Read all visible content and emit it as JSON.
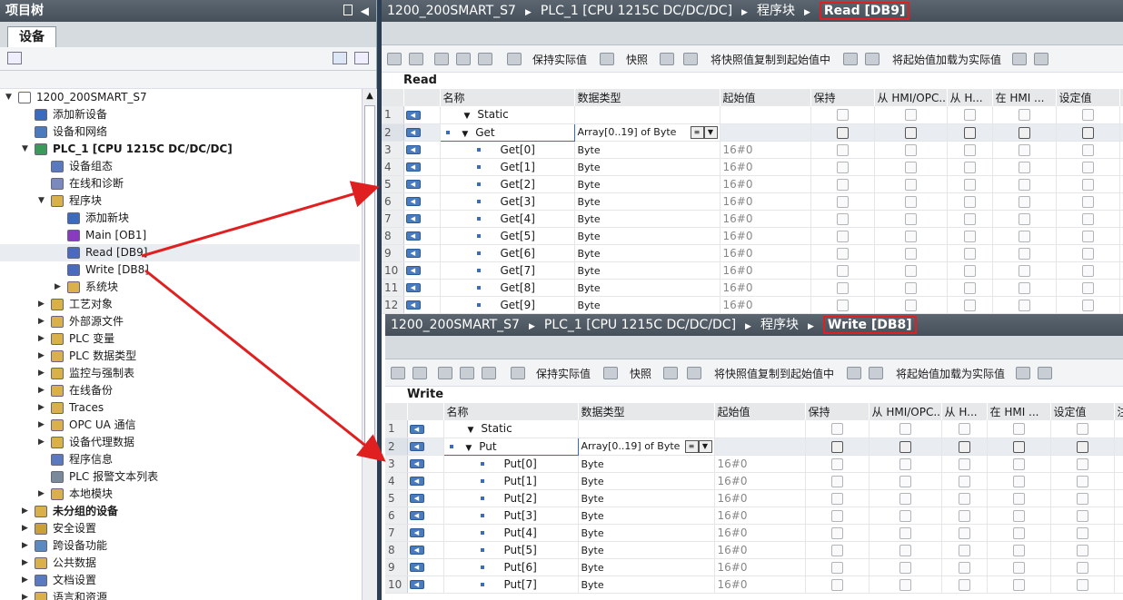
{
  "left_panel": {
    "title": "项目树",
    "tab": "设备",
    "tree": [
      {
        "label": "1200_200SMART_S7",
        "level": 0,
        "toggle": "▼",
        "icon": "project-icon",
        "color": "#fff"
      },
      {
        "label": "添加新设备",
        "level": 1,
        "toggle": "",
        "icon": "add-device-icon",
        "color": "#3a6bbf"
      },
      {
        "label": "设备和网络",
        "level": 1,
        "toggle": "",
        "icon": "network-icon",
        "color": "#4a7bbf"
      },
      {
        "label": "PLC_1 [CPU 1215C DC/DC/DC]",
        "level": 1,
        "toggle": "▼",
        "icon": "plc-icon",
        "color": "#3a9a5a",
        "bold": true
      },
      {
        "label": "设备组态",
        "level": 2,
        "toggle": "",
        "icon": "device-config-icon",
        "color": "#5a7abf"
      },
      {
        "label": "在线和诊断",
        "level": 2,
        "toggle": "",
        "icon": "online-diagnostics-icon",
        "color": "#7a8abf"
      },
      {
        "label": "程序块",
        "level": 2,
        "toggle": "▼",
        "icon": "folder-icon",
        "color": "#d9b04a"
      },
      {
        "label": "添加新块",
        "level": 3,
        "toggle": "",
        "icon": "add-block-icon",
        "color": "#3a6bbf"
      },
      {
        "label": "Main [OB1]",
        "level": 3,
        "toggle": "",
        "icon": "ob-icon",
        "color": "#8a3abf"
      },
      {
        "label": "Read [DB9]",
        "level": 3,
        "toggle": "",
        "icon": "db-icon",
        "color": "#4a6abf",
        "selected": true
      },
      {
        "label": "Write [DB8]",
        "level": 3,
        "toggle": "",
        "icon": "db-icon",
        "color": "#4a6abf"
      },
      {
        "label": "系统块",
        "level": 3,
        "toggle": "▶",
        "icon": "folder-icon",
        "color": "#d9b04a"
      },
      {
        "label": "工艺对象",
        "level": 2,
        "toggle": "▶",
        "icon": "folder-icon",
        "color": "#d9b04a"
      },
      {
        "label": "外部源文件",
        "level": 2,
        "toggle": "▶",
        "icon": "folder-icon",
        "color": "#d9b04a"
      },
      {
        "label": "PLC 变量",
        "level": 2,
        "toggle": "▶",
        "icon": "folder-icon",
        "color": "#d9b04a"
      },
      {
        "label": "PLC 数据类型",
        "level": 2,
        "toggle": "▶",
        "icon": "folder-icon",
        "color": "#d9b04a"
      },
      {
        "label": "监控与强制表",
        "level": 2,
        "toggle": "▶",
        "icon": "folder-icon",
        "color": "#d9b04a"
      },
      {
        "label": "在线备份",
        "level": 2,
        "toggle": "▶",
        "icon": "folder-icon",
        "color": "#d9b04a"
      },
      {
        "label": "Traces",
        "level": 2,
        "toggle": "▶",
        "icon": "folder-icon",
        "color": "#d9b04a"
      },
      {
        "label": "OPC UA 通信",
        "level": 2,
        "toggle": "▶",
        "icon": "folder-icon",
        "color": "#d9b04a"
      },
      {
        "label": "设备代理数据",
        "level": 2,
        "toggle": "▶",
        "icon": "folder-icon",
        "color": "#d9b04a"
      },
      {
        "label": "程序信息",
        "level": 2,
        "toggle": "",
        "icon": "program-info-icon",
        "color": "#5a7abf"
      },
      {
        "label": "PLC 报警文本列表",
        "level": 2,
        "toggle": "",
        "icon": "alarm-text-icon",
        "color": "#7a8a9a"
      },
      {
        "label": "本地模块",
        "level": 2,
        "toggle": "▶",
        "icon": "folder-icon",
        "color": "#d9b04a"
      },
      {
        "label": "未分组的设备",
        "level": 1,
        "toggle": "▶",
        "icon": "folder-icon",
        "color": "#d9b04a",
        "bold": true
      },
      {
        "label": "安全设置",
        "level": 1,
        "toggle": "▶",
        "icon": "security-icon",
        "color": "#c9a03a"
      },
      {
        "label": "跨设备功能",
        "level": 1,
        "toggle": "▶",
        "icon": "cross-device-icon",
        "color": "#5a8abf"
      },
      {
        "label": "公共数据",
        "level": 1,
        "toggle": "▶",
        "icon": "folder-icon",
        "color": "#d9b04a"
      },
      {
        "label": "文档设置",
        "level": 1,
        "toggle": "▶",
        "icon": "document-icon",
        "color": "#5a7abf"
      },
      {
        "label": "语言和资源",
        "level": 1,
        "toggle": "▶",
        "icon": "folder-icon",
        "color": "#d9b04a"
      }
    ]
  },
  "toolbar": {
    "keep_actual": "保持实际值",
    "snapshot": "快照",
    "copy_snapshot": "将快照值复制到起始值中",
    "load_start": "将起始值加载为实际值"
  },
  "columns": {
    "name": "名称",
    "datatype": "数据类型",
    "start": "起始值",
    "retain": "保持",
    "hmi_opc": "从 HMI/OPC...",
    "hmi_w": "从 H...",
    "in_hmi": "在 HMI ...",
    "setpoint": "设定值",
    "comment": "注"
  },
  "editor1": {
    "breadcrumb": [
      "1200_200SMART_S7",
      "PLC_1 [CPU 1215C DC/DC/DC]",
      "程序块",
      "Read [DB9]"
    ],
    "db_name": "Read",
    "rows": [
      {
        "no": "1",
        "name": "Static",
        "type": "",
        "start": "",
        "kind": "static"
      },
      {
        "no": "2",
        "name": "Get",
        "type": "Array[0..19] of Byte",
        "start": "",
        "kind": "array"
      },
      {
        "no": "3",
        "name": "Get[0]",
        "type": "Byte",
        "start": "16#0",
        "kind": "elem"
      },
      {
        "no": "4",
        "name": "Get[1]",
        "type": "Byte",
        "start": "16#0",
        "kind": "elem"
      },
      {
        "no": "5",
        "name": "Get[2]",
        "type": "Byte",
        "start": "16#0",
        "kind": "elem"
      },
      {
        "no": "6",
        "name": "Get[3]",
        "type": "Byte",
        "start": "16#0",
        "kind": "elem"
      },
      {
        "no": "7",
        "name": "Get[4]",
        "type": "Byte",
        "start": "16#0",
        "kind": "elem"
      },
      {
        "no": "8",
        "name": "Get[5]",
        "type": "Byte",
        "start": "16#0",
        "kind": "elem"
      },
      {
        "no": "9",
        "name": "Get[6]",
        "type": "Byte",
        "start": "16#0",
        "kind": "elem"
      },
      {
        "no": "10",
        "name": "Get[7]",
        "type": "Byte",
        "start": "16#0",
        "kind": "elem"
      },
      {
        "no": "11",
        "name": "Get[8]",
        "type": "Byte",
        "start": "16#0",
        "kind": "elem"
      },
      {
        "no": "12",
        "name": "Get[9]",
        "type": "Byte",
        "start": "16#0",
        "kind": "elem"
      }
    ]
  },
  "editor2": {
    "breadcrumb": [
      "1200_200SMART_S7",
      "PLC_1 [CPU 1215C DC/DC/DC]",
      "程序块",
      "Write [DB8]"
    ],
    "db_name": "Write",
    "rows": [
      {
        "no": "1",
        "name": "Static",
        "type": "",
        "start": "",
        "kind": "static"
      },
      {
        "no": "2",
        "name": "Put",
        "type": "Array[0..19] of Byte",
        "start": "",
        "kind": "array"
      },
      {
        "no": "3",
        "name": "Put[0]",
        "type": "Byte",
        "start": "16#0",
        "kind": "elem"
      },
      {
        "no": "4",
        "name": "Put[1]",
        "type": "Byte",
        "start": "16#0",
        "kind": "elem"
      },
      {
        "no": "5",
        "name": "Put[2]",
        "type": "Byte",
        "start": "16#0",
        "kind": "elem"
      },
      {
        "no": "6",
        "name": "Put[3]",
        "type": "Byte",
        "start": "16#0",
        "kind": "elem"
      },
      {
        "no": "7",
        "name": "Put[4]",
        "type": "Byte",
        "start": "16#0",
        "kind": "elem"
      },
      {
        "no": "8",
        "name": "Put[5]",
        "type": "Byte",
        "start": "16#0",
        "kind": "elem"
      },
      {
        "no": "9",
        "name": "Put[6]",
        "type": "Byte",
        "start": "16#0",
        "kind": "elem"
      },
      {
        "no": "10",
        "name": "Put[7]",
        "type": "Byte",
        "start": "16#0",
        "kind": "elem"
      }
    ]
  },
  "colors": {
    "highlight_box": "#e02020",
    "arrow": "#e02020",
    "header_bar": "#4f5a65"
  }
}
